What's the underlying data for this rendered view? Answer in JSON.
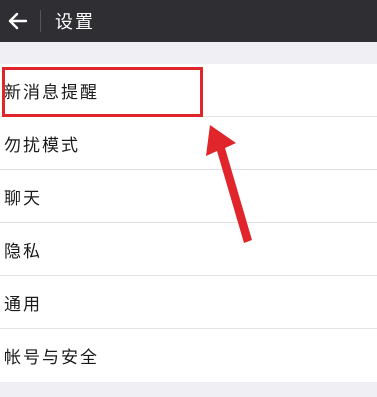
{
  "header": {
    "back_icon": "back-arrow-icon",
    "title": "设置"
  },
  "settings": {
    "items": [
      {
        "label": "新消息提醒"
      },
      {
        "label": "勿扰模式"
      },
      {
        "label": "聊天"
      },
      {
        "label": "隐私"
      },
      {
        "label": "通用"
      },
      {
        "label": "帐号与安全"
      }
    ]
  },
  "annotation": {
    "highlight_color": "#e0252b",
    "highlighted_item": "新消息提醒"
  }
}
